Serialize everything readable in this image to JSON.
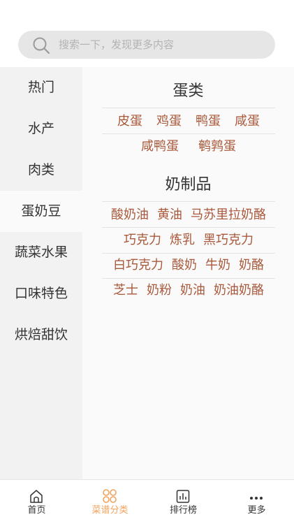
{
  "search": {
    "placeholder": "搜索一下，发现更多内容"
  },
  "sidebar": {
    "items": [
      {
        "label": "热门"
      },
      {
        "label": "水产"
      },
      {
        "label": "肉类"
      },
      {
        "label": "蛋奶豆"
      },
      {
        "label": "蔬菜水果"
      },
      {
        "label": "口味特色"
      },
      {
        "label": "烘焙甜饮"
      }
    ],
    "active_index": 3
  },
  "sections": [
    {
      "title": "蛋类",
      "rows": [
        [
          "皮蛋",
          "鸡蛋",
          "鸭蛋",
          "咸蛋"
        ],
        [
          "咸鸭蛋",
          "鹌鹑蛋"
        ]
      ]
    },
    {
      "title": "奶制品",
      "rows": [
        [
          "酸奶油",
          "黄油",
          "马苏里拉奶酪"
        ],
        [
          "巧克力",
          "炼乳",
          "黑巧克力"
        ],
        [
          "白巧克力",
          "酸奶",
          "牛奶",
          "奶酪"
        ],
        [
          "芝士",
          "奶粉",
          "奶油",
          "奶油奶酪"
        ]
      ]
    }
  ],
  "tabbar": {
    "items": [
      {
        "label": "首页",
        "icon": "home-icon"
      },
      {
        "label": "菜谱分类",
        "icon": "category-icon"
      },
      {
        "label": "排行榜",
        "icon": "ranking-icon"
      },
      {
        "label": "更多",
        "icon": "more-icon"
      }
    ],
    "active_index": 1
  },
  "colors": {
    "accent": "#f0a35e",
    "tag_text": "#a9593b",
    "sidebar_bg": "#f2f2f2",
    "search_bg": "#e6e6e6"
  }
}
